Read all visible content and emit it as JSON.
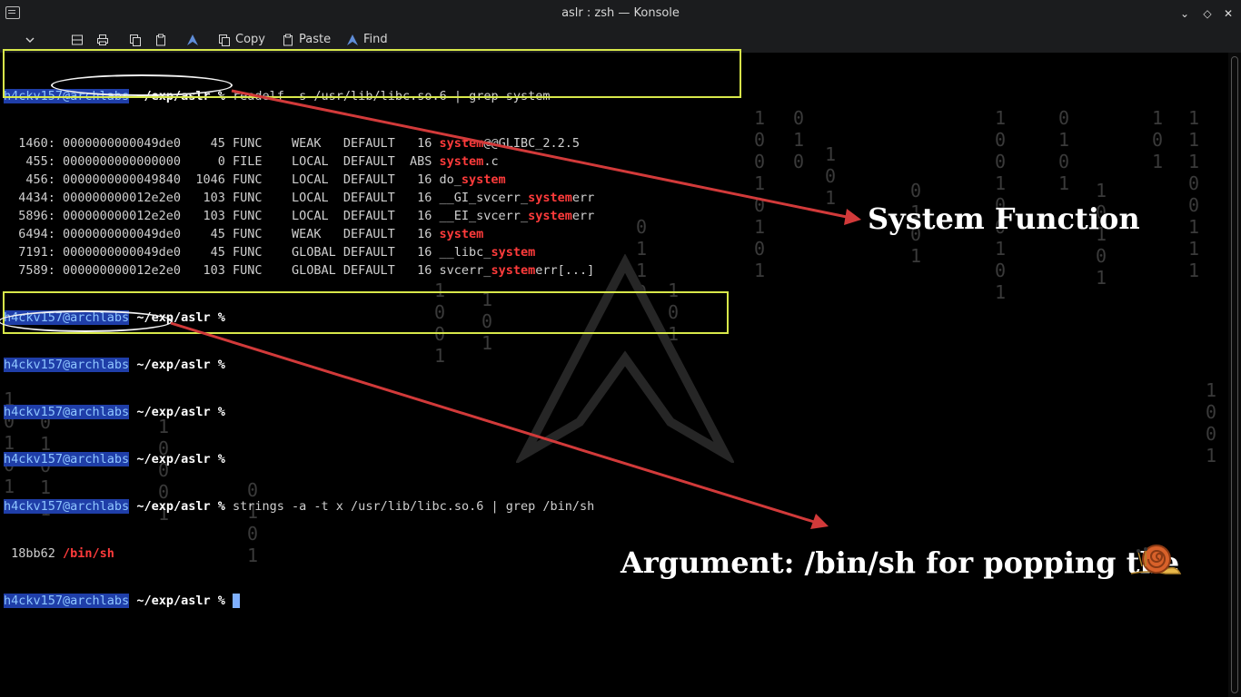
{
  "window": {
    "title": "aslr : zsh — Konsole"
  },
  "toolbar": {
    "copy_label": "Copy",
    "paste_label": "Paste",
    "find_label": "Find"
  },
  "prompt": {
    "user": "h4ckv157@archlabs",
    "path": "~/exp/aslr",
    "symbol": "%"
  },
  "terminal": {
    "cmd1": "readelf -s /usr/lib/libc.so.6 | grep system",
    "readelf_rows": [
      {
        "before": "  1460: 0000000000049de0    45 FUNC    WEAK   DEFAULT   16 ",
        "match": "system",
        "after": "@@GLIBC_2.2.5"
      },
      {
        "before": "   455: 0000000000000000     0 FILE    LOCAL  DEFAULT  ABS ",
        "match": "system",
        "after": ".c"
      },
      {
        "before": "   456: 0000000000049840  1046 FUNC    LOCAL  DEFAULT   16 do_",
        "match": "system",
        "after": ""
      },
      {
        "before": "  4434: 000000000012e2e0   103 FUNC    LOCAL  DEFAULT   16 __GI_svcerr_",
        "match": "system",
        "after": "err"
      },
      {
        "before": "  5896: 000000000012e2e0   103 FUNC    LOCAL  DEFAULT   16 __EI_svcerr_",
        "match": "system",
        "after": "err"
      },
      {
        "before": "  6494: 0000000000049de0    45 FUNC    WEAK   DEFAULT   16 ",
        "match": "system",
        "after": ""
      },
      {
        "before": "  7191: 0000000000049de0    45 FUNC    GLOBAL DEFAULT   16 __libc_",
        "match": "system",
        "after": ""
      },
      {
        "before": "  7589: 000000000012e2e0   103 FUNC    GLOBAL DEFAULT   16 svcerr_",
        "match": "system",
        "after": "err[...]"
      }
    ],
    "cmd2": "strings -a -t x /usr/lib/libc.so.6 | grep /bin/sh",
    "strings_offset": " 18bb62 ",
    "strings_match": "/bin/sh"
  },
  "annotations": {
    "system_function": "System Function",
    "argument": "Argument:  /bin/sh for popping the"
  },
  "colors": {
    "highlight_box": "#d8e84a",
    "arrow": "#d23a3a",
    "match": "#ff3b3b",
    "prompt_bg": "#1f3ea8"
  }
}
